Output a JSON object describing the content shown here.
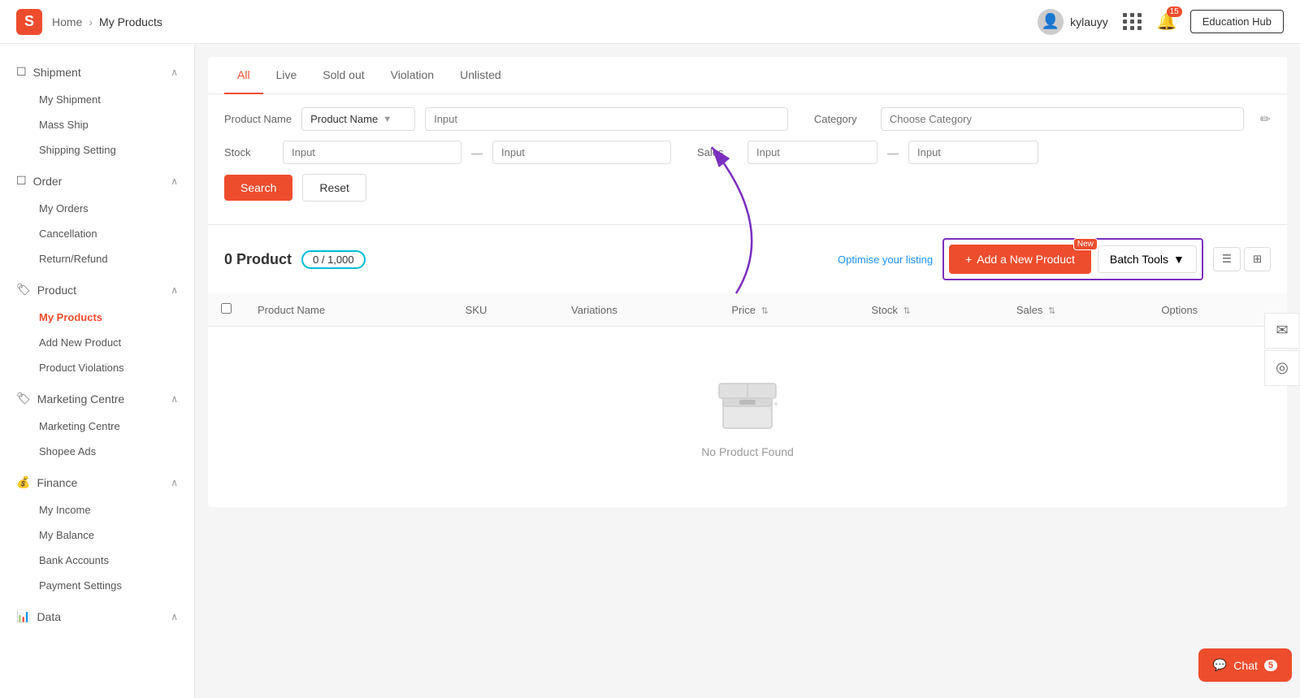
{
  "header": {
    "logo_letter": "S",
    "breadcrumb_home": "Home",
    "breadcrumb_current": "My Products",
    "username": "kylauyy",
    "notifications_count": "15",
    "education_hub_label": "Education Hub"
  },
  "sidebar": {
    "sections": [
      {
        "id": "shipment",
        "icon": "📦",
        "label": "Shipment",
        "expanded": true,
        "items": [
          {
            "id": "my-shipment",
            "label": "My Shipment",
            "active": false
          },
          {
            "id": "mass-ship",
            "label": "Mass Ship",
            "active": false
          },
          {
            "id": "shipping-setting",
            "label": "Shipping Setting",
            "active": false
          }
        ]
      },
      {
        "id": "order",
        "icon": "📋",
        "label": "Order",
        "expanded": true,
        "items": [
          {
            "id": "my-orders",
            "label": "My Orders",
            "active": false
          },
          {
            "id": "cancellation",
            "label": "Cancellation",
            "active": false
          },
          {
            "id": "return-refund",
            "label": "Return/Refund",
            "active": false
          }
        ]
      },
      {
        "id": "product",
        "icon": "🏷",
        "label": "Product",
        "expanded": true,
        "items": [
          {
            "id": "my-products",
            "label": "My Products",
            "active": true
          },
          {
            "id": "add-new-product",
            "label": "Add New Product",
            "active": false
          },
          {
            "id": "product-violations",
            "label": "Product Violations",
            "active": false
          }
        ]
      },
      {
        "id": "marketing",
        "icon": "🏷",
        "label": "Marketing Centre",
        "expanded": true,
        "items": [
          {
            "id": "marketing-centre",
            "label": "Marketing Centre",
            "active": false
          },
          {
            "id": "shopee-ads",
            "label": "Shopee Ads",
            "active": false
          }
        ]
      },
      {
        "id": "finance",
        "icon": "💰",
        "label": "Finance",
        "expanded": true,
        "items": [
          {
            "id": "my-income",
            "label": "My Income",
            "active": false
          },
          {
            "id": "my-balance",
            "label": "My Balance",
            "active": false
          },
          {
            "id": "bank-accounts",
            "label": "Bank Accounts",
            "active": false
          },
          {
            "id": "payment-settings",
            "label": "Payment Settings",
            "active": false
          }
        ]
      },
      {
        "id": "data",
        "icon": "📊",
        "label": "Data",
        "expanded": true,
        "items": []
      }
    ]
  },
  "tabs": [
    {
      "id": "all",
      "label": "All",
      "active": true
    },
    {
      "id": "live",
      "label": "Live",
      "active": false
    },
    {
      "id": "sold-out",
      "label": "Sold out",
      "active": false
    },
    {
      "id": "violation",
      "label": "Violation",
      "active": false
    },
    {
      "id": "unlisted",
      "label": "Unlisted",
      "active": false
    }
  ],
  "filters": {
    "product_name_label": "Product Name",
    "product_name_placeholder": "Input",
    "category_label": "Category",
    "category_placeholder": "Choose Category",
    "stock_label": "Stock",
    "stock_from_placeholder": "Input",
    "stock_to_placeholder": "Input",
    "sales_label": "Sales",
    "sales_from_placeholder": "Input",
    "sales_to_placeholder": "Input",
    "search_btn": "Search",
    "reset_btn": "Reset"
  },
  "toolbar": {
    "product_count": "0 Product",
    "product_limit": "0 / 1,000",
    "optimise_label": "Optimise your listing",
    "add_product_label": "Add a New Product",
    "add_product_new_badge": "New",
    "batch_tools_label": "Batch Tools"
  },
  "table": {
    "columns": [
      {
        "id": "product-name",
        "label": "Product Name"
      },
      {
        "id": "sku",
        "label": "SKU"
      },
      {
        "id": "variations",
        "label": "Variations"
      },
      {
        "id": "price",
        "label": "Price"
      },
      {
        "id": "stock",
        "label": "Stock"
      },
      {
        "id": "sales",
        "label": "Sales"
      },
      {
        "id": "options",
        "label": "Options"
      }
    ],
    "empty_text": "No Product Found"
  },
  "chat": {
    "label": "Chat",
    "badge": "5"
  },
  "right_icons": {
    "mail_icon": "✉",
    "circle_icon": "◎"
  }
}
